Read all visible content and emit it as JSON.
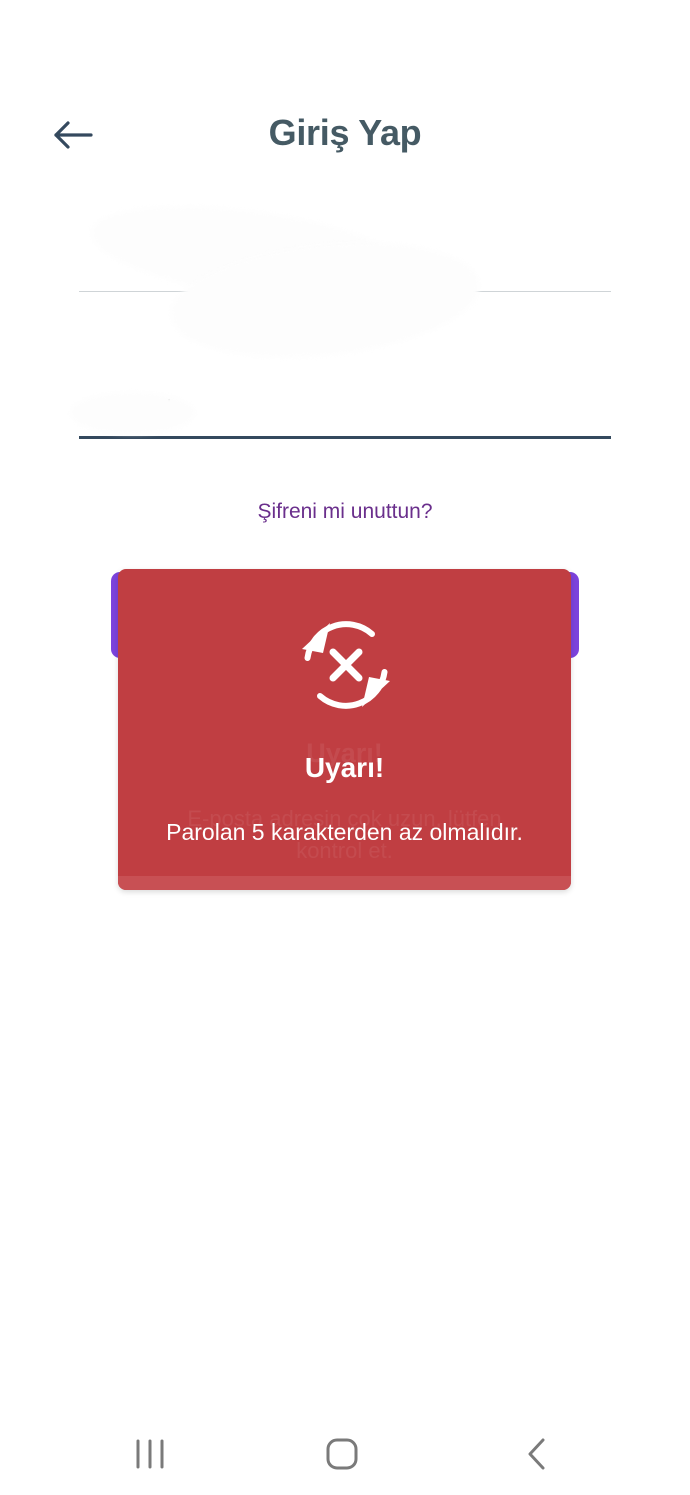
{
  "header": {
    "title": "Giriş Yap",
    "back_icon": "arrow-left-icon"
  },
  "form": {
    "email_value": "",
    "password_value": "",
    "forgot_password": "Şifreni mi unuttun?"
  },
  "alert": {
    "icon": "refresh-error-icon",
    "title": "Uyarı!",
    "message": "Parolan 5 karakterden az olmalıdır.",
    "ghost_title": "Uyarı!",
    "ghost_message": "E-posta adresin çok uzun, lütfen kontrol et."
  },
  "navbar": {
    "recents_icon": "recents-icon",
    "home_icon": "home-icon",
    "back_icon": "chevron-left-icon"
  },
  "colors": {
    "title": "#455a64",
    "link": "#6a2f8c",
    "alert_bg": "#c03e42",
    "button": "#7c43dc",
    "underline_active": "#34495e"
  }
}
